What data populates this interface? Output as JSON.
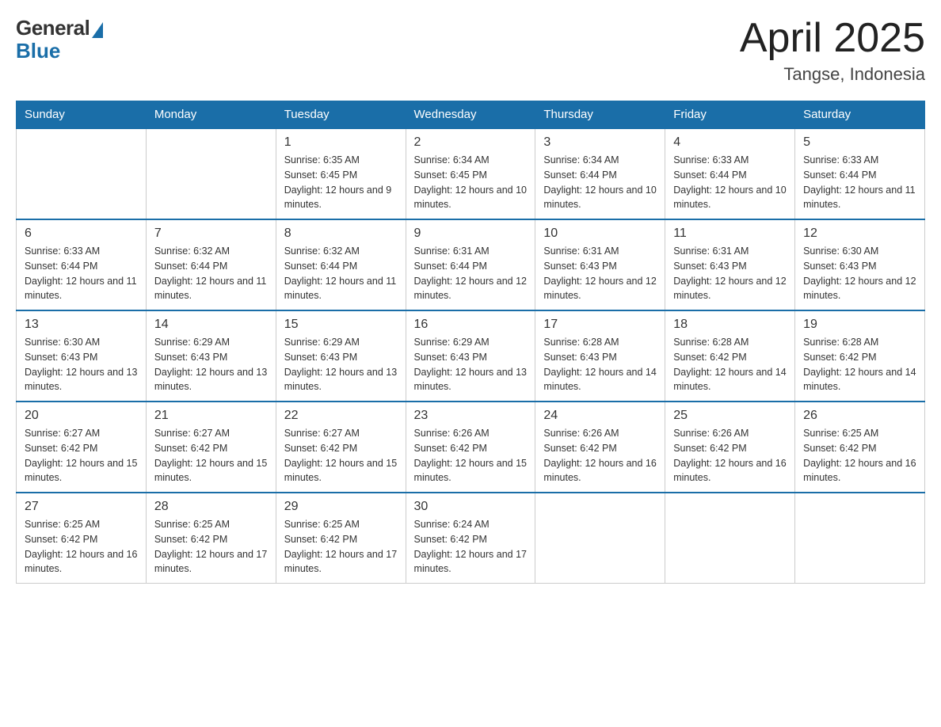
{
  "header": {
    "logo_general": "General",
    "logo_blue": "Blue",
    "title": "April 2025",
    "subtitle": "Tangse, Indonesia"
  },
  "weekdays": [
    "Sunday",
    "Monday",
    "Tuesday",
    "Wednesday",
    "Thursday",
    "Friday",
    "Saturday"
  ],
  "weeks": [
    [
      {
        "day": "",
        "sunrise": "",
        "sunset": "",
        "daylight": ""
      },
      {
        "day": "",
        "sunrise": "",
        "sunset": "",
        "daylight": ""
      },
      {
        "day": "1",
        "sunrise": "Sunrise: 6:35 AM",
        "sunset": "Sunset: 6:45 PM",
        "daylight": "Daylight: 12 hours and 9 minutes."
      },
      {
        "day": "2",
        "sunrise": "Sunrise: 6:34 AM",
        "sunset": "Sunset: 6:45 PM",
        "daylight": "Daylight: 12 hours and 10 minutes."
      },
      {
        "day": "3",
        "sunrise": "Sunrise: 6:34 AM",
        "sunset": "Sunset: 6:44 PM",
        "daylight": "Daylight: 12 hours and 10 minutes."
      },
      {
        "day": "4",
        "sunrise": "Sunrise: 6:33 AM",
        "sunset": "Sunset: 6:44 PM",
        "daylight": "Daylight: 12 hours and 10 minutes."
      },
      {
        "day": "5",
        "sunrise": "Sunrise: 6:33 AM",
        "sunset": "Sunset: 6:44 PM",
        "daylight": "Daylight: 12 hours and 11 minutes."
      }
    ],
    [
      {
        "day": "6",
        "sunrise": "Sunrise: 6:33 AM",
        "sunset": "Sunset: 6:44 PM",
        "daylight": "Daylight: 12 hours and 11 minutes."
      },
      {
        "day": "7",
        "sunrise": "Sunrise: 6:32 AM",
        "sunset": "Sunset: 6:44 PM",
        "daylight": "Daylight: 12 hours and 11 minutes."
      },
      {
        "day": "8",
        "sunrise": "Sunrise: 6:32 AM",
        "sunset": "Sunset: 6:44 PM",
        "daylight": "Daylight: 12 hours and 11 minutes."
      },
      {
        "day": "9",
        "sunrise": "Sunrise: 6:31 AM",
        "sunset": "Sunset: 6:44 PM",
        "daylight": "Daylight: 12 hours and 12 minutes."
      },
      {
        "day": "10",
        "sunrise": "Sunrise: 6:31 AM",
        "sunset": "Sunset: 6:43 PM",
        "daylight": "Daylight: 12 hours and 12 minutes."
      },
      {
        "day": "11",
        "sunrise": "Sunrise: 6:31 AM",
        "sunset": "Sunset: 6:43 PM",
        "daylight": "Daylight: 12 hours and 12 minutes."
      },
      {
        "day": "12",
        "sunrise": "Sunrise: 6:30 AM",
        "sunset": "Sunset: 6:43 PM",
        "daylight": "Daylight: 12 hours and 12 minutes."
      }
    ],
    [
      {
        "day": "13",
        "sunrise": "Sunrise: 6:30 AM",
        "sunset": "Sunset: 6:43 PM",
        "daylight": "Daylight: 12 hours and 13 minutes."
      },
      {
        "day": "14",
        "sunrise": "Sunrise: 6:29 AM",
        "sunset": "Sunset: 6:43 PM",
        "daylight": "Daylight: 12 hours and 13 minutes."
      },
      {
        "day": "15",
        "sunrise": "Sunrise: 6:29 AM",
        "sunset": "Sunset: 6:43 PM",
        "daylight": "Daylight: 12 hours and 13 minutes."
      },
      {
        "day": "16",
        "sunrise": "Sunrise: 6:29 AM",
        "sunset": "Sunset: 6:43 PM",
        "daylight": "Daylight: 12 hours and 13 minutes."
      },
      {
        "day": "17",
        "sunrise": "Sunrise: 6:28 AM",
        "sunset": "Sunset: 6:43 PM",
        "daylight": "Daylight: 12 hours and 14 minutes."
      },
      {
        "day": "18",
        "sunrise": "Sunrise: 6:28 AM",
        "sunset": "Sunset: 6:42 PM",
        "daylight": "Daylight: 12 hours and 14 minutes."
      },
      {
        "day": "19",
        "sunrise": "Sunrise: 6:28 AM",
        "sunset": "Sunset: 6:42 PM",
        "daylight": "Daylight: 12 hours and 14 minutes."
      }
    ],
    [
      {
        "day": "20",
        "sunrise": "Sunrise: 6:27 AM",
        "sunset": "Sunset: 6:42 PM",
        "daylight": "Daylight: 12 hours and 15 minutes."
      },
      {
        "day": "21",
        "sunrise": "Sunrise: 6:27 AM",
        "sunset": "Sunset: 6:42 PM",
        "daylight": "Daylight: 12 hours and 15 minutes."
      },
      {
        "day": "22",
        "sunrise": "Sunrise: 6:27 AM",
        "sunset": "Sunset: 6:42 PM",
        "daylight": "Daylight: 12 hours and 15 minutes."
      },
      {
        "day": "23",
        "sunrise": "Sunrise: 6:26 AM",
        "sunset": "Sunset: 6:42 PM",
        "daylight": "Daylight: 12 hours and 15 minutes."
      },
      {
        "day": "24",
        "sunrise": "Sunrise: 6:26 AM",
        "sunset": "Sunset: 6:42 PM",
        "daylight": "Daylight: 12 hours and 16 minutes."
      },
      {
        "day": "25",
        "sunrise": "Sunrise: 6:26 AM",
        "sunset": "Sunset: 6:42 PM",
        "daylight": "Daylight: 12 hours and 16 minutes."
      },
      {
        "day": "26",
        "sunrise": "Sunrise: 6:25 AM",
        "sunset": "Sunset: 6:42 PM",
        "daylight": "Daylight: 12 hours and 16 minutes."
      }
    ],
    [
      {
        "day": "27",
        "sunrise": "Sunrise: 6:25 AM",
        "sunset": "Sunset: 6:42 PM",
        "daylight": "Daylight: 12 hours and 16 minutes."
      },
      {
        "day": "28",
        "sunrise": "Sunrise: 6:25 AM",
        "sunset": "Sunset: 6:42 PM",
        "daylight": "Daylight: 12 hours and 17 minutes."
      },
      {
        "day": "29",
        "sunrise": "Sunrise: 6:25 AM",
        "sunset": "Sunset: 6:42 PM",
        "daylight": "Daylight: 12 hours and 17 minutes."
      },
      {
        "day": "30",
        "sunrise": "Sunrise: 6:24 AM",
        "sunset": "Sunset: 6:42 PM",
        "daylight": "Daylight: 12 hours and 17 minutes."
      },
      {
        "day": "",
        "sunrise": "",
        "sunset": "",
        "daylight": ""
      },
      {
        "day": "",
        "sunrise": "",
        "sunset": "",
        "daylight": ""
      },
      {
        "day": "",
        "sunrise": "",
        "sunset": "",
        "daylight": ""
      }
    ]
  ]
}
